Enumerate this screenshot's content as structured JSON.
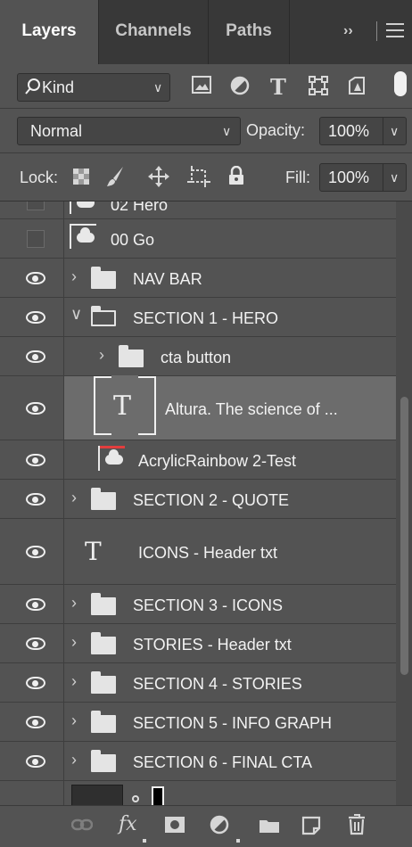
{
  "tabs": [
    {
      "label": "Layers",
      "active": true
    },
    {
      "label": "Channels",
      "active": false
    },
    {
      "label": "Paths",
      "active": false
    }
  ],
  "tab_overflow": "››",
  "filter": {
    "kind_label": "Kind",
    "icons": [
      "pixel-filter-icon",
      "adjustment-filter-icon",
      "type-filter-icon",
      "shape-filter-icon",
      "smart-object-filter-icon",
      "filter-toggle-icon"
    ]
  },
  "blend": {
    "mode": "Normal",
    "opacity_label": "Opacity:",
    "opacity_value": "100%"
  },
  "lock": {
    "label": "Lock:",
    "fill_label": "Fill:",
    "fill_value": "100%",
    "icons": [
      "lock-transparent-pixels-icon",
      "lock-image-pixels-icon",
      "lock-position-icon",
      "lock-artboard-icon",
      "lock-all-icon"
    ]
  },
  "layers": [
    {
      "name": "02 Hero",
      "visible": false,
      "kind": "smart",
      "indent": 0
    },
    {
      "name": "00 Go",
      "visible": false,
      "kind": "smart",
      "indent": 0
    },
    {
      "name": "NAV BAR",
      "visible": true,
      "kind": "folder",
      "indent": 0
    },
    {
      "name": "SECTION 1 - HERO",
      "visible": true,
      "kind": "folder-open",
      "indent": 0
    },
    {
      "name": "cta button",
      "visible": true,
      "kind": "folder",
      "indent": 1
    },
    {
      "name": "Altura. The science of ...",
      "visible": true,
      "kind": "text-selected",
      "indent": 1
    },
    {
      "name": "AcrylicRainbow 2-Test",
      "visible": true,
      "kind": "smart",
      "indent": 1
    },
    {
      "name": "SECTION 2 - QUOTE",
      "visible": true,
      "kind": "folder",
      "indent": 0
    },
    {
      "name": "ICONS - Header txt",
      "visible": true,
      "kind": "text",
      "indent": 0
    },
    {
      "name": "SECTION 3 - ICONS",
      "visible": true,
      "kind": "folder",
      "indent": 0
    },
    {
      "name": "STORIES - Header txt",
      "visible": true,
      "kind": "folder",
      "indent": 0
    },
    {
      "name": "SECTION 4 - STORIES",
      "visible": true,
      "kind": "folder",
      "indent": 0
    },
    {
      "name": "SECTION 5 - INFO GRAPH",
      "visible": true,
      "kind": "folder",
      "indent": 0
    },
    {
      "name": "SECTION 6 - FINAL CTA",
      "visible": true,
      "kind": "folder",
      "indent": 0
    }
  ],
  "bottom_bar": [
    "link-layers-icon",
    "fx-icon",
    "add-mask-icon",
    "adjustment-layer-icon",
    "new-group-icon",
    "new-layer-icon",
    "delete-layer-icon"
  ],
  "fx_label": "fx",
  "text_glyph": "T"
}
